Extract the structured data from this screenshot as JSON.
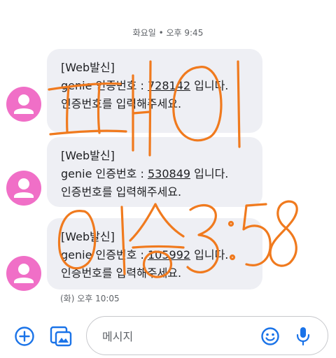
{
  "conversation": {
    "top_timestamp": "화요일 • 오후 9:45",
    "bottom_timestamp": "(화) 오후 10:05",
    "messages": [
      {
        "line1": "[Web발신]",
        "line2_prefix": "genie 인증번호 : ",
        "code": "728142",
        "line2_suffix": " 입니다.",
        "line3": "인증번호를 입력해주세요."
      },
      {
        "line1": "[Web발신]",
        "line2_prefix": "genie 인증번호 : ",
        "code": "530849",
        "line2_suffix": " 입니다.",
        "line3": "인증번호를 입력해주세요."
      },
      {
        "line1": "[Web발신]",
        "line2_prefix": "genie 인증번호 : ",
        "code": "105992",
        "line2_suffix": " 입니다.",
        "line3": "인증번호를 입력해주세요."
      }
    ]
  },
  "composer": {
    "placeholder": "메시지"
  },
  "colors": {
    "avatar": "#f06fc7",
    "bubble": "#eeeff4",
    "accent": "#1a73e8",
    "handwriting": "#f07a1e"
  },
  "icons": [
    "person-icon",
    "add-icon",
    "gallery-icon",
    "emoji-icon",
    "microphone-icon"
  ]
}
